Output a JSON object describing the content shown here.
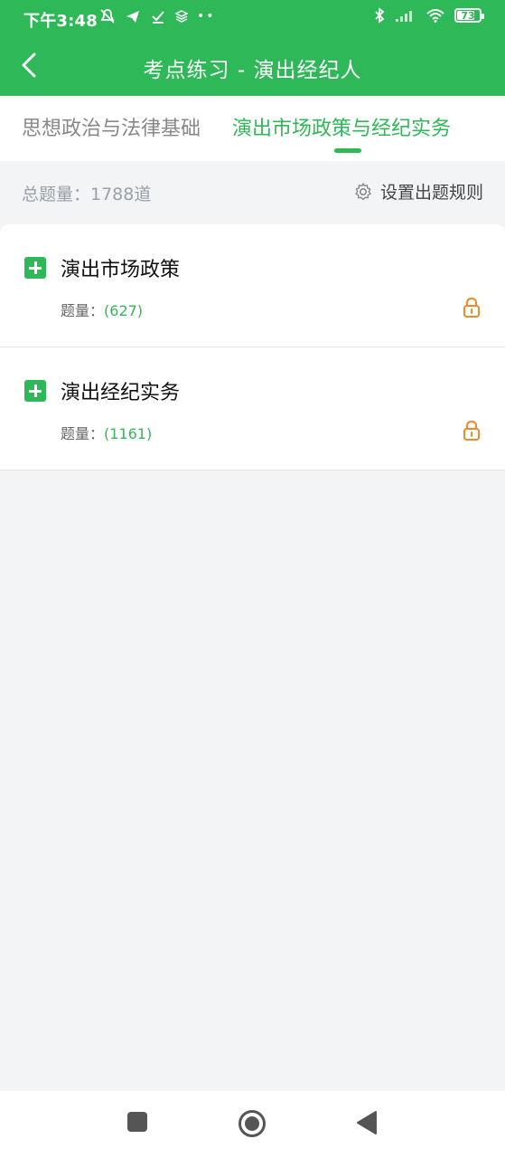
{
  "status_bar": {
    "time": "下午3:48",
    "battery": "73"
  },
  "header": {
    "title": "考点练习 - 演出经纪人",
    "back_icon": "chevron-left-icon"
  },
  "tabs": [
    {
      "label": "思想政治与法律基础",
      "active": false
    },
    {
      "label": "演出市场政策与经纪实务",
      "active": true
    }
  ],
  "summary": {
    "total_label": "总题量：1788道",
    "rules_label": "设置出题规则"
  },
  "items": [
    {
      "title": "演出市场政策",
      "count_label": "题量：",
      "count": "(627)",
      "locked": true
    },
    {
      "title": "演出经纪实务",
      "count_label": "题量：",
      "count": "(1161)",
      "locked": true
    }
  ],
  "colors": {
    "accent": "#2fb857",
    "lock": "#f08a2a"
  }
}
